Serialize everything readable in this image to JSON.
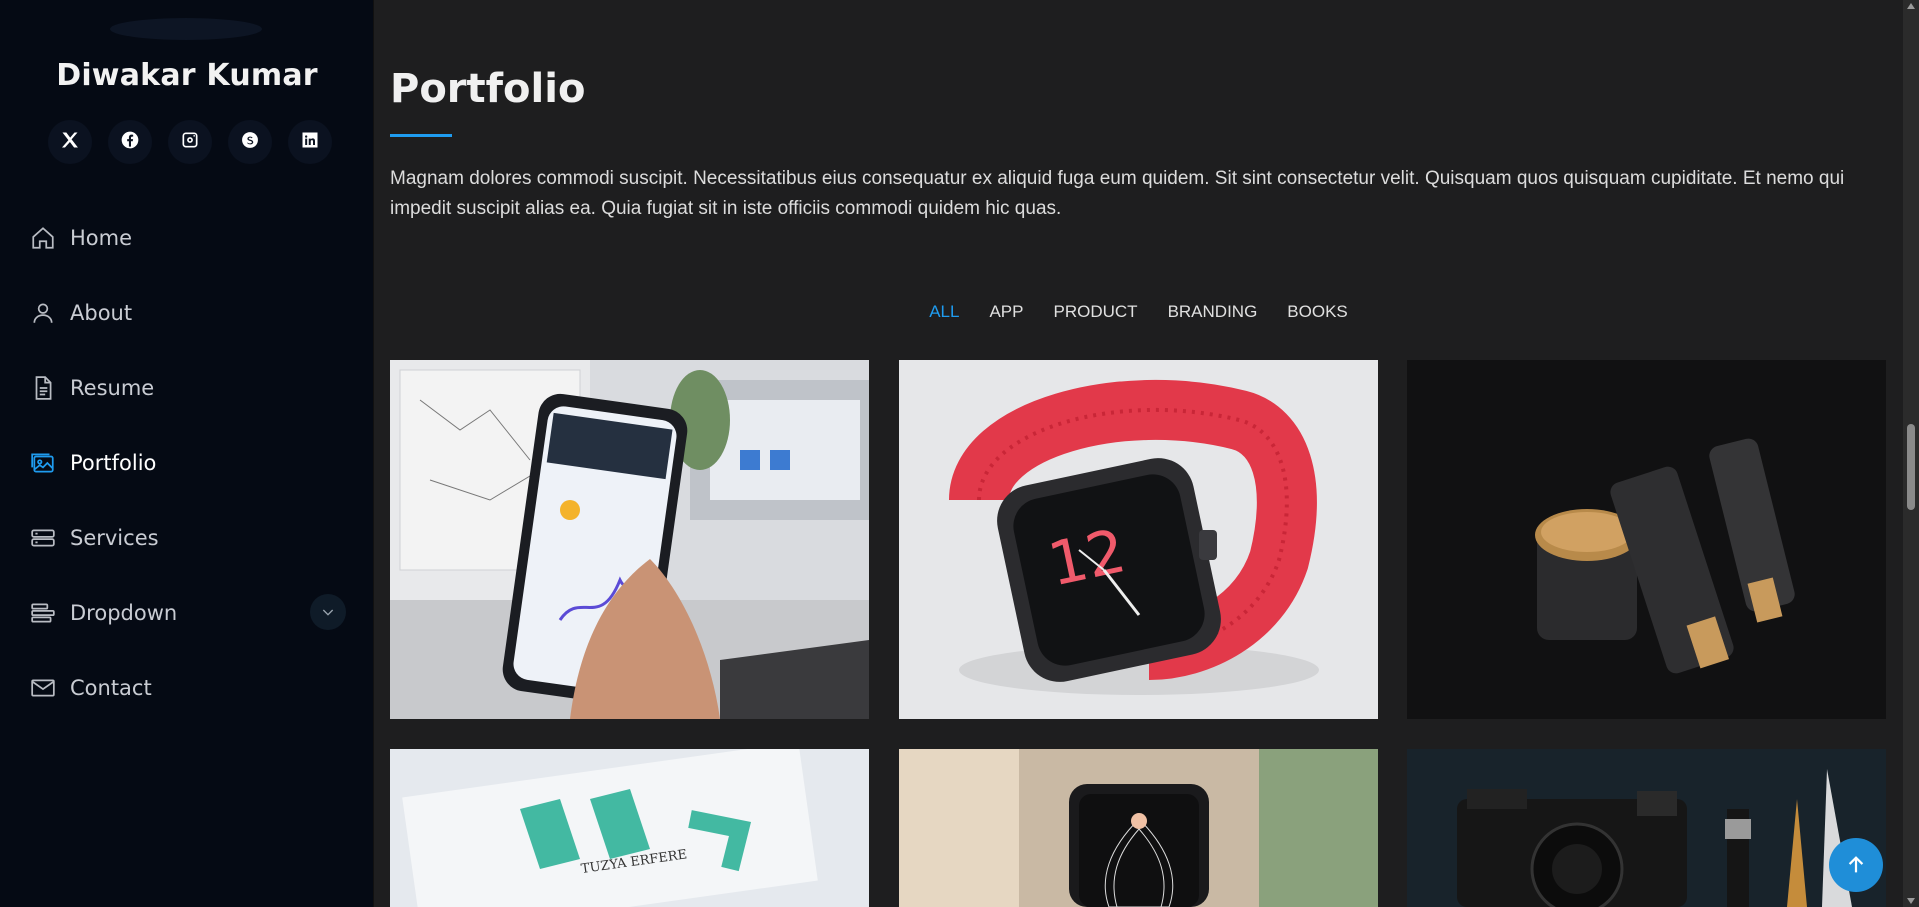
{
  "sidebar": {
    "name": "Diwakar Kumar",
    "socials": [
      {
        "icon": "x-twitter-icon"
      },
      {
        "icon": "facebook-icon"
      },
      {
        "icon": "instagram-icon"
      },
      {
        "icon": "skype-icon"
      },
      {
        "icon": "linkedin-icon"
      }
    ],
    "nav": [
      {
        "label": "Home",
        "icon": "house-icon",
        "active": false
      },
      {
        "label": "About",
        "icon": "person-icon",
        "active": false
      },
      {
        "label": "Resume",
        "icon": "file-text-icon",
        "active": false
      },
      {
        "label": "Portfolio",
        "icon": "images-icon",
        "active": true
      },
      {
        "label": "Services",
        "icon": "hdd-stack-icon",
        "active": false
      },
      {
        "label": "Dropdown",
        "icon": "menu-icon",
        "active": false
      },
      {
        "label": "Contact",
        "icon": "envelope-icon",
        "active": false
      }
    ]
  },
  "main": {
    "title": "Portfolio",
    "description": "Magnam dolores commodi suscipit. Necessitatibus eius consequatur ex aliquid fuga eum quidem. Sit sint consectetur velit. Quisquam quos quisquam cupiditate. Et nemo qui impedit suscipit alias ea. Quia fugiat sit in iste officiis commodi quidem hic quas.",
    "filters": [
      "ALL",
      "APP",
      "PRODUCT",
      "BRANDING",
      "BOOKS"
    ],
    "active_filter": "ALL"
  },
  "colors": {
    "accent": "#1f9cf0",
    "sidebar_bg": "#050a14",
    "main_bg": "#1e1e1f"
  }
}
